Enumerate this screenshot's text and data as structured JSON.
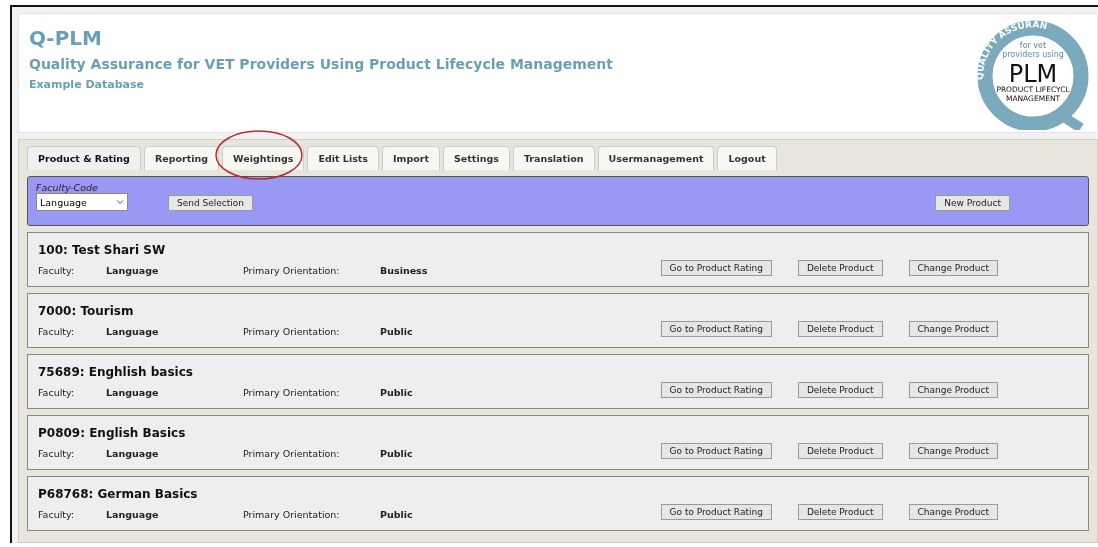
{
  "header": {
    "title": "Q-PLM",
    "subtitle": "Quality Assurance for VET Providers Using Product Lifecycle Management",
    "database": "Example Database"
  },
  "logo": {
    "arc_text": "QUALITY ASSURAN",
    "line_1": "for vet",
    "line_2": "providers using",
    "mark": "PLM",
    "line_3": "PRODUCT LIFECYCL",
    "line_4": "MANAGEMENT"
  },
  "tabs": [
    {
      "label": "Product & Rating",
      "selected": true,
      "circled": false
    },
    {
      "label": "Reporting",
      "selected": false,
      "circled": false
    },
    {
      "label": "Weightings",
      "selected": false,
      "circled": true
    },
    {
      "label": "Edit Lists",
      "selected": false,
      "circled": false
    },
    {
      "label": "Import",
      "selected": false,
      "circled": false
    },
    {
      "label": "Settings",
      "selected": false,
      "circled": false
    },
    {
      "label": "Translation",
      "selected": false,
      "circled": false
    },
    {
      "label": "Usermanagement",
      "selected": false,
      "circled": false
    },
    {
      "label": "Logout",
      "selected": false,
      "circled": false
    }
  ],
  "filter": {
    "label": "Faculty-Code",
    "value": "Language",
    "send_button": "Send Selection",
    "new_button": "New Product"
  },
  "products": [
    {
      "title": "100: Test Shari SW",
      "faculty_label": "Faculty:",
      "faculty": "Language",
      "orientation_label": "Primary Orientation:",
      "orientation": "Business",
      "buttons": [
        "Go to Product Rating",
        "Delete Product",
        "Change Product"
      ]
    },
    {
      "title": "7000: Tourism",
      "faculty_label": "Faculty:",
      "faculty": "Language",
      "orientation_label": "Primary Orientation:",
      "orientation": "Public",
      "buttons": [
        "Go to Product Rating",
        "Delete Product",
        "Change Product"
      ]
    },
    {
      "title": "75689: Enghlish basics",
      "faculty_label": "Faculty:",
      "faculty": "Language",
      "orientation_label": "Primary Orientation:",
      "orientation": "Public",
      "buttons": [
        "Go to Product Rating",
        "Delete Product",
        "Change Product"
      ]
    },
    {
      "title": "P0809: English Basics",
      "faculty_label": "Faculty:",
      "faculty": "Language",
      "orientation_label": "Primary Orientation:",
      "orientation": "Public",
      "buttons": [
        "Go to Product Rating",
        "Delete Product",
        "Change Product"
      ]
    },
    {
      "title": "P68768: German Basics",
      "faculty_label": "Faculty:",
      "faculty": "Language",
      "orientation_label": "Primary Orientation:",
      "orientation": "Public",
      "buttons": [
        "Go to Product Rating",
        "Delete Product",
        "Change Product"
      ]
    }
  ]
}
